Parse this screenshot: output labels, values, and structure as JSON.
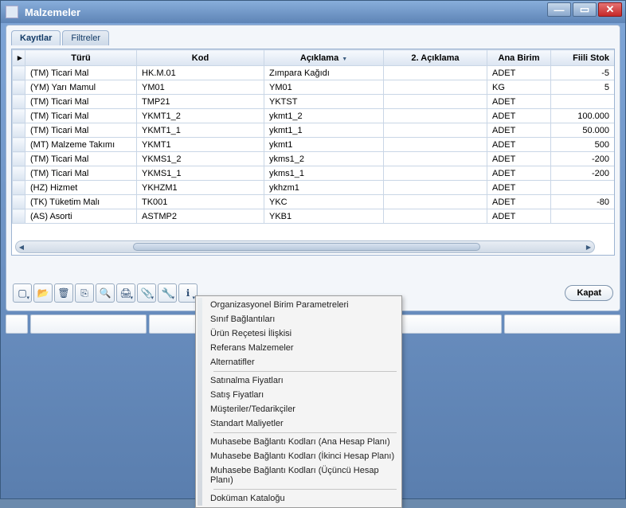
{
  "window": {
    "title": "Malzemeler"
  },
  "tabs": [
    {
      "label": "Kayıtlar",
      "active": true
    },
    {
      "label": "Filtreler",
      "active": false
    }
  ],
  "columns": {
    "turu": "Türü",
    "kod": "Kod",
    "aciklama": "Açıklama",
    "aciklama2": "2. Açıklama",
    "anabirim": "Ana Birim",
    "fiilistok": "Fiili Stok"
  },
  "rows": [
    {
      "turu": "(TM) Ticari Mal",
      "kod": "HK.M.01",
      "aciklama": "Zımpara Kağıdı",
      "aciklama2": "",
      "anabirim": "ADET",
      "stok": "-5"
    },
    {
      "turu": "(YM) Yarı Mamul",
      "kod": "YM01",
      "aciklama": "YM01",
      "aciklama2": "",
      "anabirim": "KG",
      "stok": "5"
    },
    {
      "turu": "(TM) Ticari Mal",
      "kod": "TMP21",
      "aciklama": "YKTST",
      "aciklama2": "",
      "anabirim": "ADET",
      "stok": ""
    },
    {
      "turu": "(TM) Ticari Mal",
      "kod": "YKMT1_2",
      "aciklama": "ykmt1_2",
      "aciklama2": "",
      "anabirim": "ADET",
      "stok": "100.000"
    },
    {
      "turu": "(TM) Ticari Mal",
      "kod": "YKMT1_1",
      "aciklama": "ykmt1_1",
      "aciklama2": "",
      "anabirim": "ADET",
      "stok": "50.000"
    },
    {
      "turu": "(MT) Malzeme Takımı",
      "kod": "YKMT1",
      "aciklama": "ykmt1",
      "aciklama2": "",
      "anabirim": "ADET",
      "stok": "500"
    },
    {
      "turu": "(TM) Ticari Mal",
      "kod": "YKMS1_2",
      "aciklama": "ykms1_2",
      "aciklama2": "",
      "anabirim": "ADET",
      "stok": "-200"
    },
    {
      "turu": "(TM) Ticari Mal",
      "kod": "YKMS1_1",
      "aciklama": "ykms1_1",
      "aciklama2": "",
      "anabirim": "ADET",
      "stok": "-200"
    },
    {
      "turu": "(HZ) Hizmet",
      "kod": "YKHZM1",
      "aciklama": "ykhzm1",
      "aciklama2": "",
      "anabirim": "ADET",
      "stok": ""
    },
    {
      "turu": "(TK) Tüketim Malı",
      "kod": "TK001",
      "aciklama": "YKC",
      "aciklama2": "",
      "anabirim": "ADET",
      "stok": "-80"
    },
    {
      "turu": "(AS) Asorti",
      "kod": "ASTMP2",
      "aciklama": "YKB1",
      "aciklama2": "",
      "anabirim": "ADET",
      "stok": ""
    }
  ],
  "toolbar": {
    "close": "Kapat"
  },
  "popup": {
    "group1": [
      "Organizasyonel Birim Parametreleri",
      "Sınıf Bağlantıları",
      "Ürün Reçetesi İlişkisi",
      "Referans Malzemeler",
      "Alternatifler"
    ],
    "group2": [
      "Satınalma Fiyatları",
      "Satış Fiyatları",
      "Müşteriler/Tedarikçiler",
      "Standart Maliyetler"
    ],
    "group3": [
      "Muhasebe Bağlantı Kodları (Ana Hesap Planı)",
      "Muhasebe Bağlantı Kodları (İkinci Hesap Planı)",
      "Muhasebe Bağlantı Kodları (Üçüncü Hesap Planı)"
    ],
    "group4": [
      "Doküman Kataloğu"
    ]
  },
  "icons": {
    "new": "▢",
    "open": "📂",
    "delete": "🗑",
    "copy": "⎘",
    "find": "🔍",
    "print": "🖨",
    "attach": "📎",
    "tool": "🔧",
    "info": "ℹ"
  }
}
